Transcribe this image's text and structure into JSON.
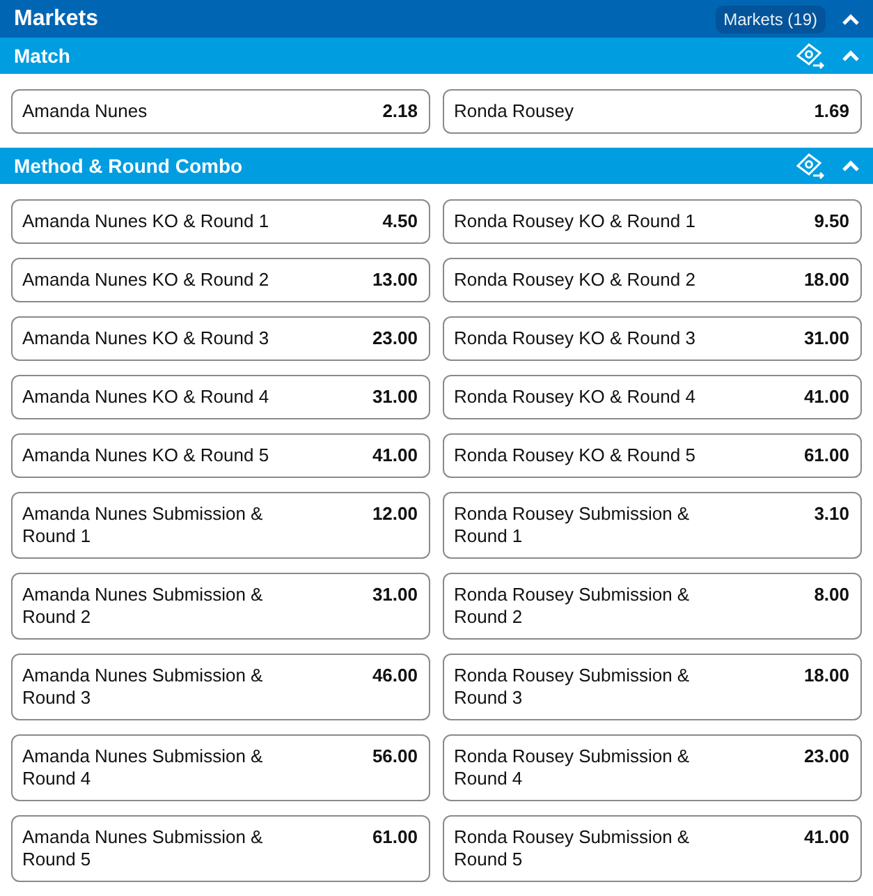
{
  "header": {
    "title": "Markets",
    "count_badge": "Markets (19)",
    "expanded": true
  },
  "sections": [
    {
      "title": "Match",
      "expanded": true,
      "selections": [
        {
          "label": "Amanda Nunes",
          "odds": "2.18"
        },
        {
          "label": "Ronda Rousey",
          "odds": "1.69"
        }
      ]
    },
    {
      "title": "Method & Round Combo",
      "expanded": true,
      "selections": [
        {
          "label": "Amanda Nunes KO & Round 1",
          "odds": "4.50"
        },
        {
          "label": "Ronda Rousey KO & Round 1",
          "odds": "9.50"
        },
        {
          "label": "Amanda Nunes KO & Round 2",
          "odds": "13.00"
        },
        {
          "label": "Ronda Rousey KO & Round 2",
          "odds": "18.00"
        },
        {
          "label": "Amanda Nunes KO & Round 3",
          "odds": "23.00"
        },
        {
          "label": "Ronda Rousey KO & Round 3",
          "odds": "31.00"
        },
        {
          "label": "Amanda Nunes KO & Round 4",
          "odds": "31.00"
        },
        {
          "label": "Ronda Rousey KO & Round 4",
          "odds": "41.00"
        },
        {
          "label": "Amanda Nunes KO & Round 5",
          "odds": "41.00"
        },
        {
          "label": "Ronda Rousey KO & Round 5",
          "odds": "61.00"
        },
        {
          "label": "Amanda Nunes Submission & Round 1",
          "odds": "12.00"
        },
        {
          "label": "Ronda Rousey Submission & Round 1",
          "odds": "3.10"
        },
        {
          "label": "Amanda Nunes Submission & Round 2",
          "odds": "31.00"
        },
        {
          "label": "Ronda Rousey Submission & Round 2",
          "odds": "8.00"
        },
        {
          "label": "Amanda Nunes Submission & Round 3",
          "odds": "46.00"
        },
        {
          "label": "Ronda Rousey Submission & Round 3",
          "odds": "18.00"
        },
        {
          "label": "Amanda Nunes Submission & Round 4",
          "odds": "56.00"
        },
        {
          "label": "Ronda Rousey Submission & Round 4",
          "odds": "23.00"
        },
        {
          "label": "Amanda Nunes Submission & Round 5",
          "odds": "61.00"
        },
        {
          "label": "Ronda Rousey Submission & Round 5",
          "odds": "41.00"
        }
      ]
    }
  ]
}
